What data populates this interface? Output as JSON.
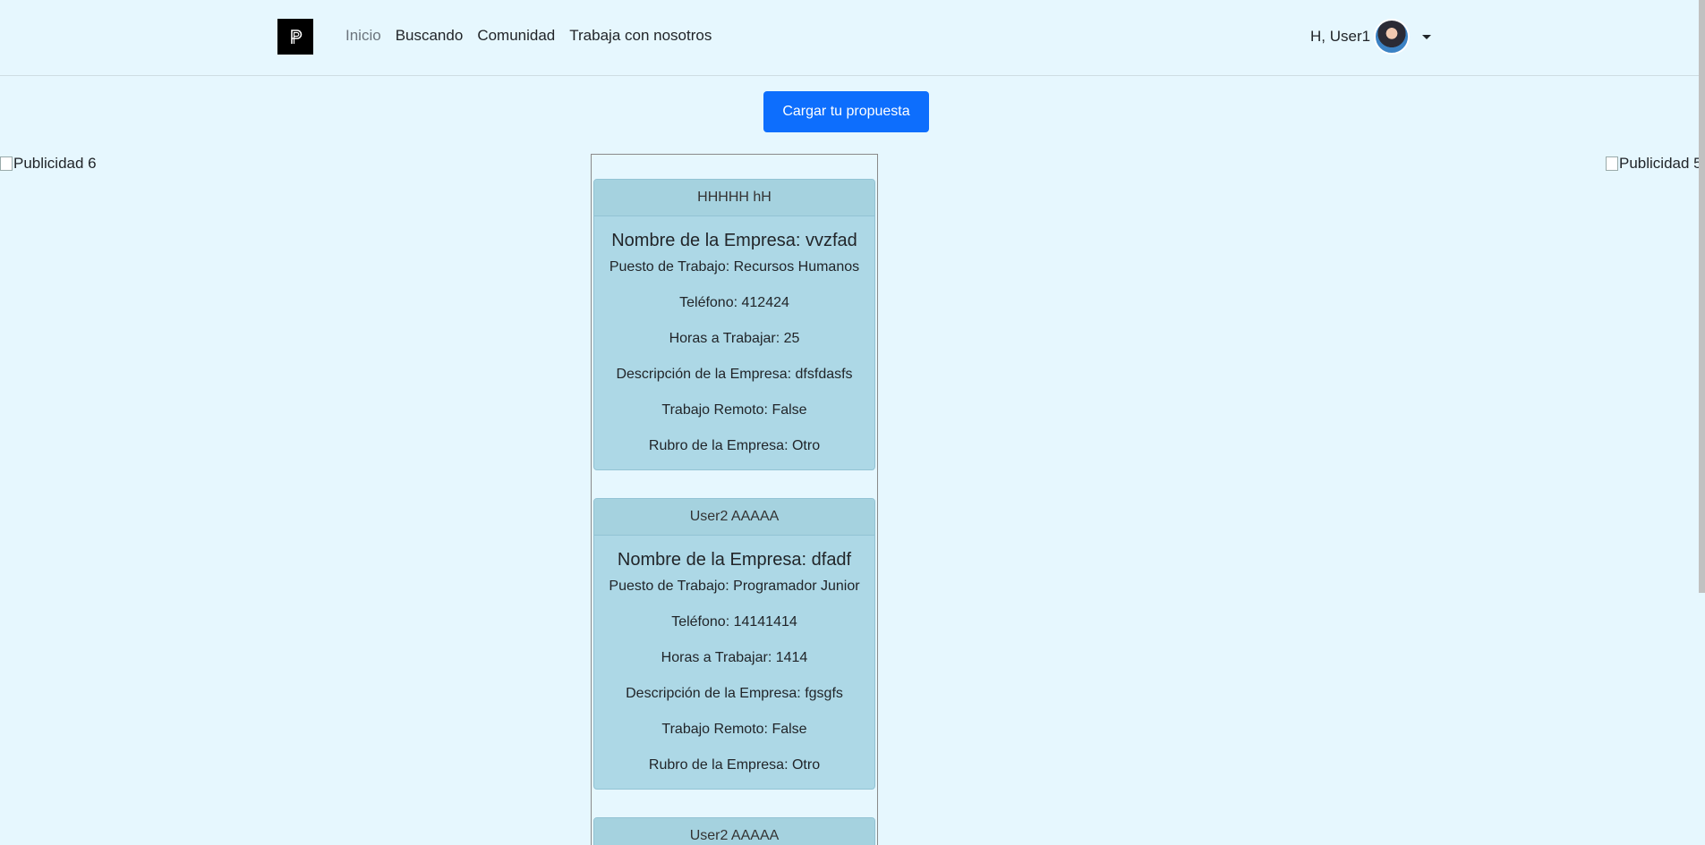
{
  "navbar": {
    "links": [
      "Inicio",
      "Buscando",
      "Comunidad",
      "Trabaja con nosotros"
    ],
    "user_greeting": "H, User1"
  },
  "cta_label": "Cargar tu propuesta",
  "ads": {
    "left": "Publicidad 6",
    "right": "Publicidad 5"
  },
  "cards": [
    {
      "header": "HHHHH hH",
      "title": "Nombre de la Empresa: vvzfad",
      "lines": [
        "Puesto de Trabajo: Recursos Humanos",
        "Teléfono: 412424",
        "Horas a Trabajar: 25",
        "Descripción de la Empresa: dfsfdasfs",
        "Trabajo Remoto: False",
        "Rubro de la Empresa: Otro"
      ]
    },
    {
      "header": "User2 AAAAA",
      "title": "Nombre de la Empresa: dfadf",
      "lines": [
        "Puesto de Trabajo: Programador Junior",
        "Teléfono: 14141414",
        "Horas a Trabajar: 1414",
        "Descripción de la Empresa: fgsgfs",
        "Trabajo Remoto: False",
        "Rubro de la Empresa: Otro"
      ]
    },
    {
      "header": "User2 AAAAA"
    }
  ]
}
